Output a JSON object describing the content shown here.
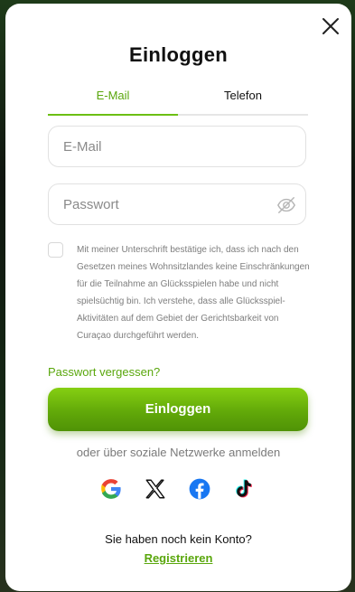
{
  "modal": {
    "title": "Einloggen",
    "close_icon": "close-icon"
  },
  "tabs": [
    {
      "label": "E-Mail",
      "active": true
    },
    {
      "label": "Telefon",
      "active": false
    }
  ],
  "fields": {
    "email": {
      "placeholder": "E-Mail",
      "value": ""
    },
    "password": {
      "placeholder": "Passwort",
      "value": "",
      "toggle_icon": "eye-off-icon"
    }
  },
  "consent": {
    "checked": false,
    "text": "Mit meiner Unterschrift bestätige ich, dass ich nach den Gesetzen meines Wohnsitzlandes keine Einschränkungen für die Teilnahme an Glücksspielen habe und nicht spielsüchtig bin. Ich verstehe, dass alle Glücksspiel-Aktivitäten auf dem Gebiet der Gerichtsbarkeit von Curaçao durchgeführt werden."
  },
  "forgot_password": "Passwort vergessen?",
  "login_button": "Einloggen",
  "social": {
    "caption": "oder über soziale Netzwerke anmelden",
    "providers": [
      "google-icon",
      "x-icon",
      "facebook-icon",
      "tiktok-icon"
    ]
  },
  "footer": {
    "no_account": "Sie haben noch kein Konto?",
    "register": "Registrieren"
  },
  "colors": {
    "accent": "#6cbf13",
    "accent_text": "#5aa70d",
    "button_gradient_top": "#86cf12",
    "button_gradient_bottom": "#4f9206"
  }
}
